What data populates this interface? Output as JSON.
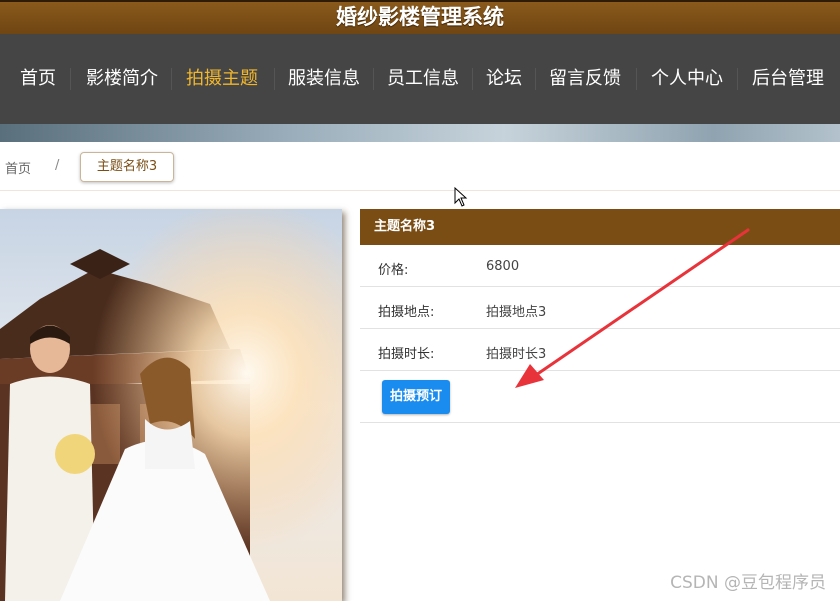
{
  "header": {
    "title": "婚纱影楼管理系统"
  },
  "nav": {
    "items": [
      {
        "label": "首页"
      },
      {
        "label": "影楼简介"
      },
      {
        "label": "拍摄主题"
      },
      {
        "label": "服装信息"
      },
      {
        "label": "员工信息"
      },
      {
        "label": "论坛"
      },
      {
        "label": "留言反馈"
      },
      {
        "label": "个人中心"
      },
      {
        "label": "后台管理"
      }
    ],
    "active_index": 2,
    "active_color": "#f0b62d"
  },
  "breadcrumb": {
    "home": "首页",
    "separator": "/",
    "current": "主题名称3"
  },
  "detail": {
    "title": "主题名称3",
    "rows": [
      {
        "key": "价格:",
        "value": "6800"
      },
      {
        "key": "拍摄地点:",
        "value": "拍摄地点3"
      },
      {
        "key": "拍摄时长:",
        "value": "拍摄时长3"
      }
    ],
    "book_button": "拍摄预订",
    "accent_color": "#7a4d14",
    "button_color": "#1a8cf0"
  },
  "photo": {
    "subject": "wedding-couple-photo"
  },
  "watermark": "CSDN @豆包程序员"
}
